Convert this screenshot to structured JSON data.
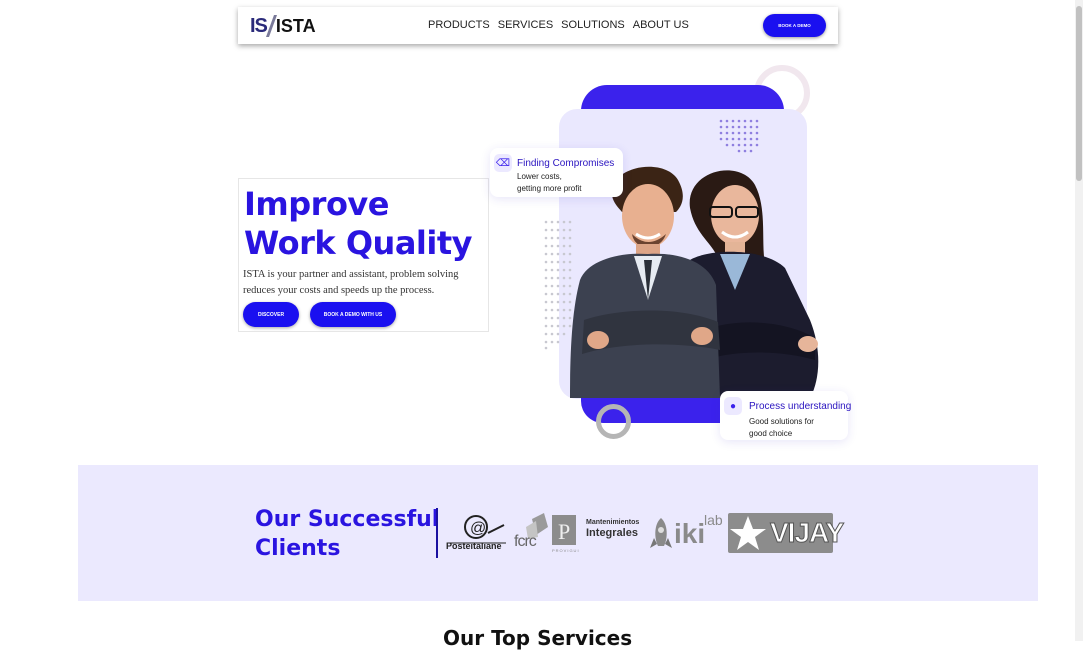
{
  "nav": {
    "logo_is": "IS",
    "logo_ista": "ISTA",
    "menu": [
      "PRODUCTS",
      "SERVICES",
      "SOLUTIONS",
      "ABOUT US"
    ],
    "cta_label": "BOOK A DEMO"
  },
  "hero": {
    "title_line1": "Improve",
    "title_line2": "Work Quality",
    "subtitle": "ISTA is your partner and assistant, problem solving reduces your costs and speeds up the process.",
    "discover_label": "DISCOVER",
    "demo_label": "BOOK A DEMO WITH US"
  },
  "feature_cards": {
    "card1": {
      "title": "Finding Compromises",
      "line1": "Lower costs,",
      "line2": "getting more profit",
      "icon": "ticket-icon"
    },
    "card2": {
      "title": "Process understanding",
      "line1": "Good solutions for",
      "line2": "good choice",
      "icon": "apple-icon"
    }
  },
  "clients": {
    "title_line1": "Our Successful",
    "title_line2": "Clients",
    "logos": {
      "poste": "Posteitaliane",
      "fcrc": "fcrc",
      "provigui": "PROVIGUI",
      "mant_line1": "Mantenimientos",
      "mant_line2": "Integrales",
      "iki": "iki",
      "lab": "lab",
      "vijay": "VIJAY"
    }
  },
  "next_section": {
    "title": "Our Top Services"
  },
  "colors": {
    "accent": "#2a14e0",
    "button": "#1a10f0",
    "panel": "#ebe9fe"
  }
}
